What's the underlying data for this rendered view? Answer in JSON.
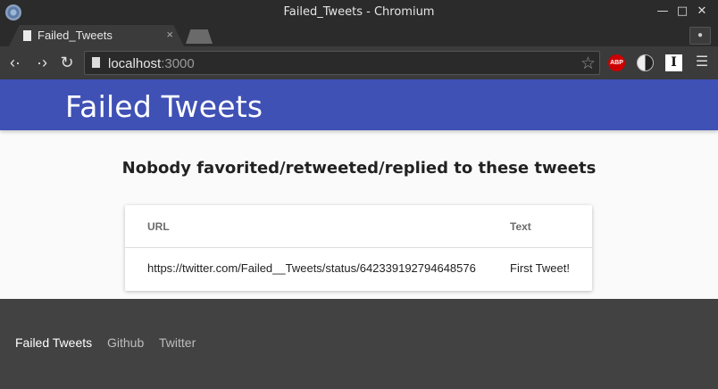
{
  "window": {
    "title": "Failed_Tweets - Chromium",
    "controls": {
      "minimize": "—",
      "maximize": "□",
      "close": "✕"
    }
  },
  "tabs": [
    {
      "label": "Failed_Tweets",
      "close": "×"
    }
  ],
  "toolbar": {
    "url_host": "localhost",
    "url_port": ":3000",
    "extensions": {
      "adblock": "ABP",
      "instapaper": "I"
    }
  },
  "app": {
    "title": "Failed Tweets",
    "header_color": "#3f51b5"
  },
  "main": {
    "heading": "Nobody favorited/retweeted/replied to these tweets",
    "table": {
      "columns": [
        "URL",
        "Text"
      ],
      "rows": [
        {
          "url": "https://twitter.com/Failed__Tweets/status/642339192794648576",
          "text": "First Tweet!"
        }
      ]
    }
  },
  "footer": {
    "brand": "Failed Tweets",
    "links": [
      "Github",
      "Twitter"
    ],
    "background": "#424242"
  }
}
